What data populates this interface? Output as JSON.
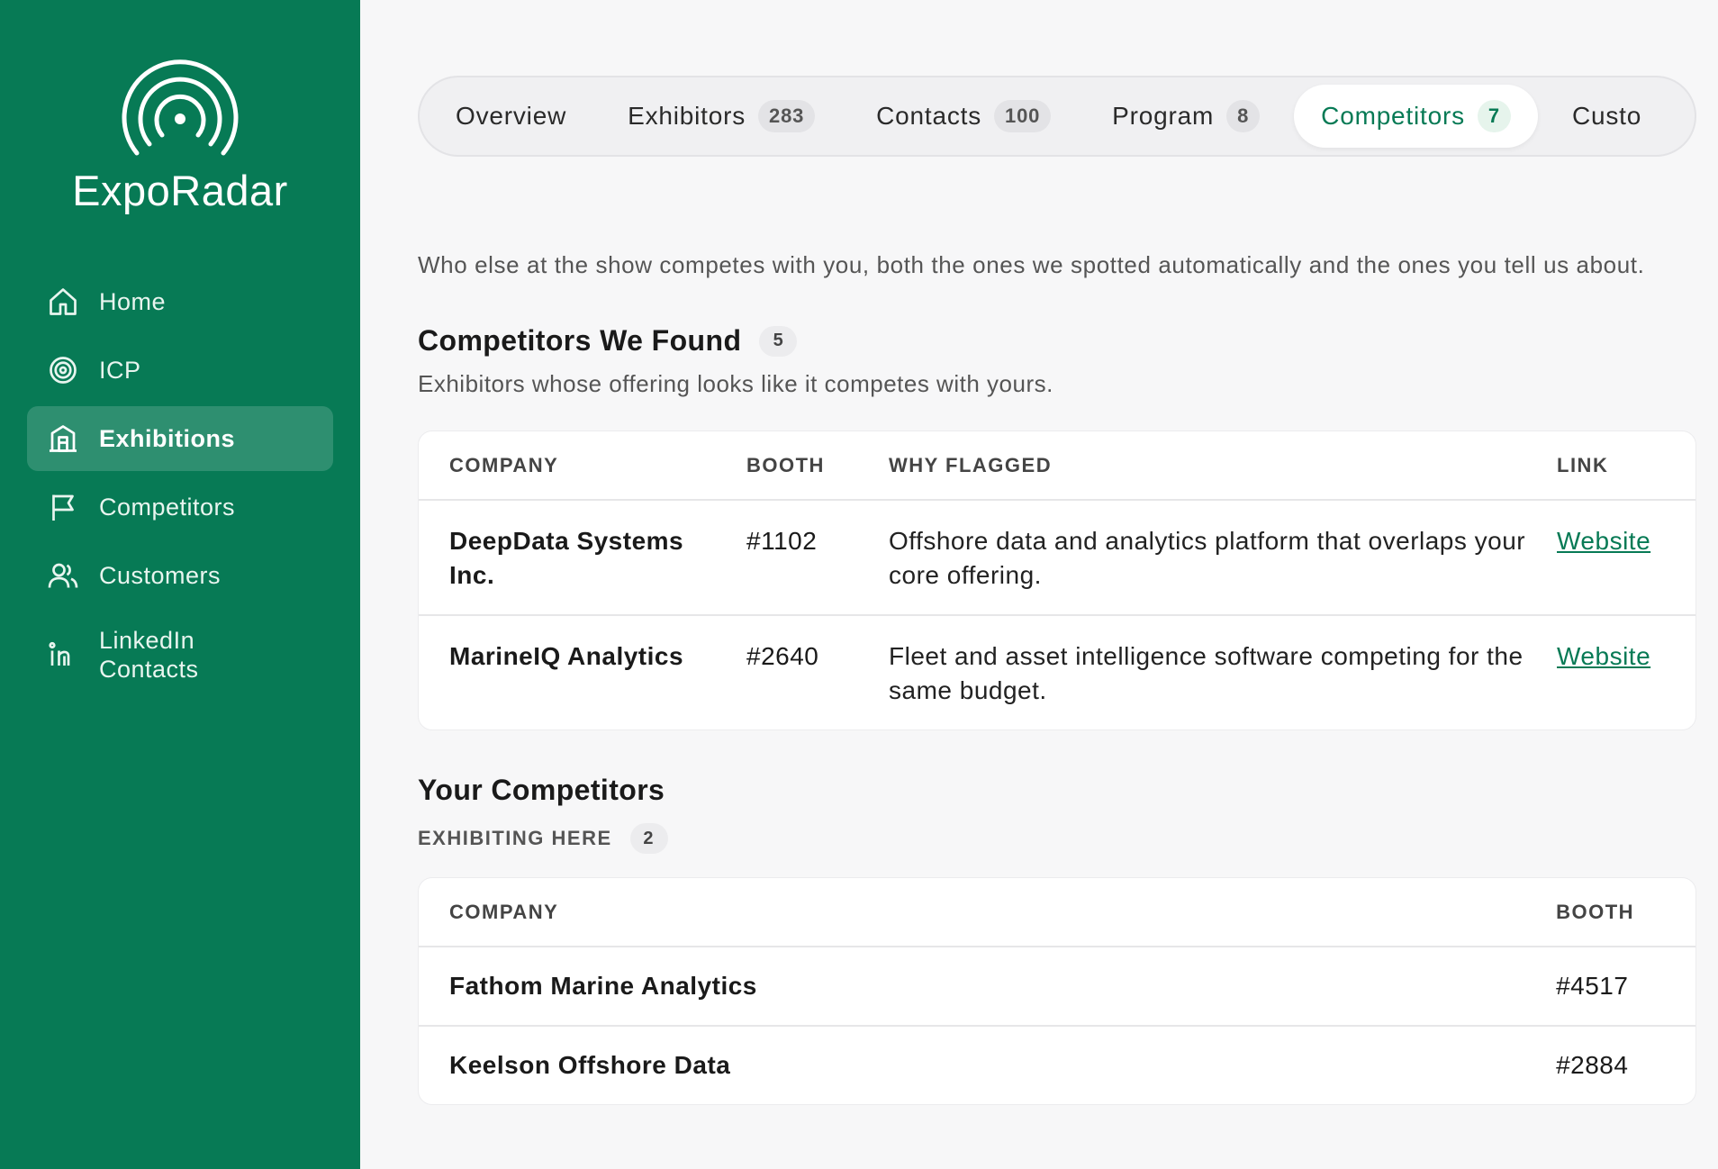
{
  "brand": {
    "name": "ExpoRadar"
  },
  "sidebar": {
    "items": [
      {
        "label": "Home",
        "icon": "home-icon",
        "active": false
      },
      {
        "label": "ICP",
        "icon": "target-icon",
        "active": false
      },
      {
        "label": "Exhibitions",
        "icon": "building-icon",
        "active": true
      },
      {
        "label": "Competitors",
        "icon": "flag-icon",
        "active": false
      },
      {
        "label": "Customers",
        "icon": "users-icon",
        "active": false
      },
      {
        "label": "LinkedIn Contacts",
        "icon": "linkedin-icon",
        "active": false
      }
    ]
  },
  "tabs": [
    {
      "label": "Overview",
      "count": null
    },
    {
      "label": "Exhibitors",
      "count": "283"
    },
    {
      "label": "Contacts",
      "count": "100"
    },
    {
      "label": "Program",
      "count": "8"
    },
    {
      "label": "Competitors",
      "count": "7",
      "active": true
    },
    {
      "label": "Custo",
      "count": null
    }
  ],
  "intro": "Who else at the show competes with you, both the ones we spotted automatically and the ones you tell us about.",
  "found": {
    "title": "Competitors We Found",
    "count": "5",
    "subtitle": "Exhibitors whose offering looks like it competes with yours.",
    "columns": [
      "COMPANY",
      "BOOTH",
      "WHY FLAGGED",
      "LINK"
    ],
    "rows": [
      {
        "company": "DeepData Systems Inc.",
        "booth": "#1102",
        "why": "Offshore data and analytics platform that overlaps your core offering.",
        "link": "Website"
      },
      {
        "company": "MarineIQ Analytics",
        "booth": "#2640",
        "why": "Fleet and asset intelligence software competing for the same budget.",
        "link": "Website"
      }
    ]
  },
  "yours": {
    "title": "Your Competitors",
    "exhibiting_label": "EXHIBITING HERE",
    "count": "2",
    "columns": [
      "COMPANY",
      "BOOTH"
    ],
    "rows": [
      {
        "company": "Fathom Marine Analytics",
        "booth": "#4517"
      },
      {
        "company": "Keelson Offshore Data",
        "booth": "#2884"
      }
    ]
  },
  "colors": {
    "brand_green": "#077a55",
    "active_text": "#077a55"
  }
}
